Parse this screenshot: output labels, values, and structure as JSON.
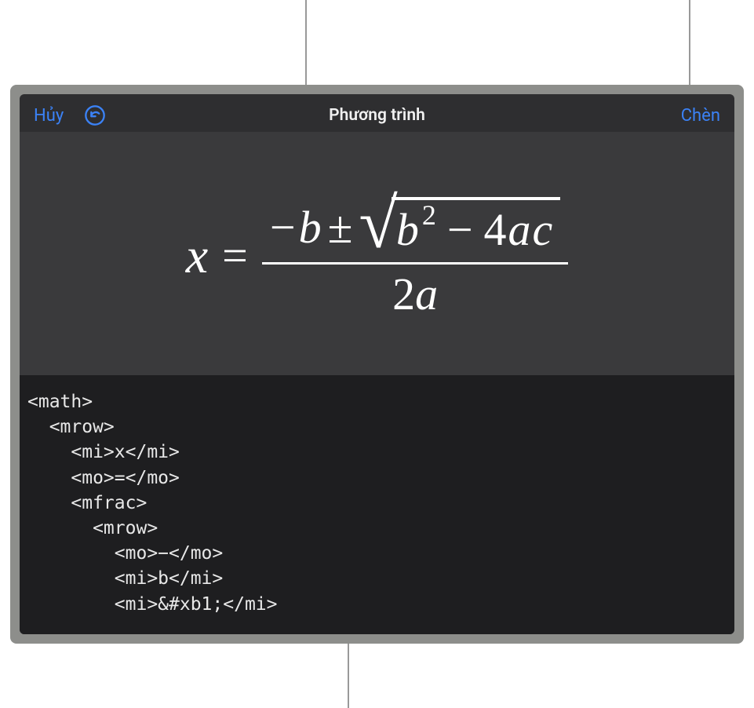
{
  "header": {
    "cancel_label": "Hủy",
    "title": "Phương trình",
    "insert_label": "Chèn"
  },
  "equation": {
    "variable": "x",
    "equals": "=",
    "neg": "−",
    "b": "b",
    "pm": "±",
    "sqrt_b": "b",
    "sqrt_exp": "2",
    "minus": "−",
    "four": "4",
    "a": "a",
    "c": "c",
    "den_two": "2",
    "den_a": "a"
  },
  "code": {
    "text": "<math>\n  <mrow>\n    <mi>x</mi>\n    <mo>=</mo>\n    <mfrac>\n      <mrow>\n        <mo>−</mo>\n        <mi>b</mi>\n        <mi>&#xb1;</mi>"
  }
}
